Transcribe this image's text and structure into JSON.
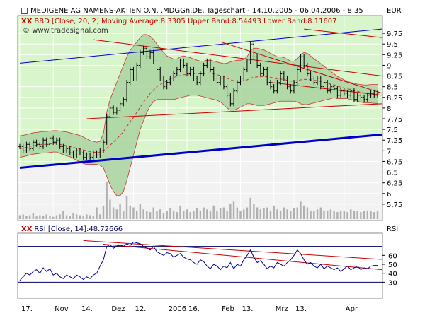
{
  "header": {
    "title": "MEDIGENE AG NAMENS-AKTIEN O.N. ,MDGGn.DE, Tageschart - 14.10.2005 - 06.04.2006 - 8.35",
    "bbd_legend": "BBD [Close, 20, 2] Moving Average:8.3305 Upper Band:8.54493 Lower Band:8.11607",
    "watermark": "www.tradesignal.com",
    "currency": "EUR"
  },
  "rsi_panel": {
    "legend": "RSI [Close, 14]:48.72666",
    "axis_label": "RSI"
  },
  "colors": {
    "upper_bg": "#d9f5cc",
    "lower_bg": "#f2f2f2",
    "band_fill": "#a9d3a0",
    "band_lower_excess": "#bdbdbd",
    "band_edge": "#cc3333",
    "moving_average": "#cc3333",
    "price": "#000000",
    "trend_blue": "#0000cc",
    "trend_red": "#cc0000",
    "rsi_line": "#000099",
    "volume": "#b0b0b0"
  },
  "chart_data": [
    {
      "type": "line",
      "title": "MEDIGENE AG NAMENS-AKTIEN O.N. ,MDGGn.DE, Tageschart - 14.10.2005 - 06.04.2006 - 8.35",
      "ylabel": "EUR",
      "ylim": [
        5.5,
        10.0
      ],
      "yticks": [
        "5,75",
        "6",
        "6,25",
        "6,5",
        "6,75",
        "7",
        "7,25",
        "7,5",
        "7,75",
        "8",
        "8,25",
        "8,5",
        "8,75",
        "9",
        "9,25",
        "9,5",
        "9,75"
      ],
      "xticks": [
        "17.",
        "Nov",
        "14.",
        "Dez",
        "12.",
        "2006",
        "16.",
        "Feb",
        "13.",
        "Mrz",
        "13.",
        "Apr"
      ],
      "series": [
        {
          "name": "Close",
          "values": [
            7.1,
            7.0,
            7.15,
            7.05,
            7.2,
            7.15,
            7.1,
            7.25,
            7.15,
            7.3,
            7.2,
            7.25,
            7.1,
            7.0,
            7.05,
            6.95,
            6.9,
            7.0,
            6.95,
            6.85,
            6.9,
            6.85,
            6.95,
            6.9,
            7.0,
            7.2,
            7.8,
            8.0,
            7.9,
            7.95,
            8.1,
            8.2,
            8.6,
            8.9,
            8.7,
            9.0,
            9.3,
            9.4,
            9.2,
            9.3,
            9.1,
            8.9,
            8.7,
            8.5,
            8.6,
            8.7,
            8.8,
            8.9,
            9.1,
            9.0,
            8.8,
            8.9,
            8.7,
            8.6,
            8.8,
            9.0,
            9.1,
            8.9,
            8.7,
            8.6,
            8.7,
            8.5,
            8.3,
            8.1,
            8.4,
            8.6,
            8.7,
            8.9,
            9.1,
            9.5,
            9.2,
            9.0,
            8.8,
            8.9,
            8.6,
            8.5,
            8.4,
            8.6,
            8.8,
            8.7,
            8.5,
            8.4,
            8.6,
            8.9,
            9.2,
            9.0,
            8.8,
            8.7,
            8.6,
            8.7,
            8.5,
            8.6,
            8.4,
            8.5,
            8.45,
            8.3,
            8.4,
            8.35,
            8.3,
            8.4,
            8.2,
            8.3,
            8.25,
            8.2,
            8.3,
            8.35,
            8.3,
            8.35
          ]
        },
        {
          "name": "Moving Average",
          "values": [
            7.05,
            7.06,
            7.08,
            7.1,
            7.12,
            7.13,
            7.14,
            7.15,
            7.15,
            7.16,
            7.17,
            7.17,
            7.15,
            7.13,
            7.12,
            7.1,
            7.08,
            7.06,
            7.04,
            7.02,
            7.0,
            6.98,
            6.97,
            6.96,
            6.97,
            7.0,
            7.06,
            7.13,
            7.2,
            7.28,
            7.36,
            7.45,
            7.56,
            7.68,
            7.78,
            7.9,
            8.02,
            8.14,
            8.24,
            8.34,
            8.42,
            8.5,
            8.55,
            8.6,
            8.64,
            8.68,
            8.72,
            8.74,
            8.76,
            8.78,
            8.78,
            8.8,
            8.8,
            8.8,
            8.8,
            8.8,
            8.82,
            8.82,
            8.8,
            8.78,
            8.76,
            8.74,
            8.7,
            8.66,
            8.64,
            8.63,
            8.63,
            8.64,
            8.66,
            8.7,
            8.72,
            8.73,
            8.73,
            8.74,
            8.73,
            8.72,
            8.7,
            8.68,
            8.68,
            8.67,
            8.65,
            8.63,
            8.63,
            8.64,
            8.66,
            8.67,
            8.67,
            8.66,
            8.65,
            8.64,
            8.62,
            8.6,
            8.58,
            8.56,
            8.54,
            8.51,
            8.49,
            8.47,
            8.45,
            8.43,
            8.41,
            8.39,
            8.37,
            8.35,
            8.34,
            8.34,
            8.33,
            8.33
          ]
        },
        {
          "name": "Upper Band",
          "values": [
            7.35,
            7.36,
            7.38,
            7.4,
            7.42,
            7.43,
            7.44,
            7.45,
            7.45,
            7.46,
            7.47,
            7.47,
            7.46,
            7.45,
            7.44,
            7.42,
            7.4,
            7.38,
            7.36,
            7.32,
            7.28,
            7.24,
            7.22,
            7.2,
            7.22,
            7.4,
            7.9,
            8.2,
            8.4,
            8.6,
            8.8,
            9.0,
            9.2,
            9.35,
            9.45,
            9.55,
            9.65,
            9.72,
            9.72,
            9.68,
            9.6,
            9.5,
            9.4,
            9.3,
            9.22,
            9.18,
            9.15,
            9.15,
            9.2,
            9.22,
            9.2,
            9.18,
            9.15,
            9.12,
            9.1,
            9.1,
            9.12,
            9.12,
            9.1,
            9.08,
            9.06,
            9.04,
            9.05,
            9.08,
            9.1,
            9.12,
            9.12,
            9.14,
            9.2,
            9.35,
            9.4,
            9.4,
            9.38,
            9.36,
            9.32,
            9.28,
            9.24,
            9.2,
            9.2,
            9.18,
            9.14,
            9.1,
            9.1,
            9.15,
            9.25,
            9.3,
            9.28,
            9.22,
            9.15,
            9.1,
            9.04,
            8.98,
            8.92,
            8.86,
            8.8,
            8.74,
            8.7,
            8.66,
            8.62,
            8.6,
            8.58,
            8.56,
            8.55,
            8.54,
            8.54,
            8.55,
            8.55,
            8.55
          ]
        },
        {
          "name": "Lower Band",
          "values": [
            6.85,
            6.86,
            6.88,
            6.9,
            6.92,
            6.93,
            6.94,
            6.95,
            6.95,
            6.96,
            6.97,
            6.97,
            6.94,
            6.91,
            6.88,
            6.86,
            6.82,
            6.78,
            6.74,
            6.7,
            6.68,
            6.68,
            6.68,
            6.68,
            6.66,
            6.6,
            6.4,
            6.2,
            6.05,
            5.95,
            5.95,
            6.05,
            6.3,
            6.6,
            6.9,
            7.2,
            7.5,
            7.7,
            7.9,
            8.05,
            8.15,
            8.2,
            8.2,
            8.2,
            8.2,
            8.2,
            8.2,
            8.22,
            8.24,
            8.26,
            8.28,
            8.3,
            8.3,
            8.3,
            8.28,
            8.26,
            8.24,
            8.22,
            8.2,
            8.18,
            8.14,
            8.08,
            8.0,
            7.95,
            7.95,
            7.98,
            8.02,
            8.06,
            8.1,
            8.1,
            8.08,
            8.06,
            8.06,
            8.06,
            8.08,
            8.1,
            8.12,
            8.14,
            8.16,
            8.16,
            8.16,
            8.16,
            8.16,
            8.14,
            8.1,
            8.08,
            8.08,
            8.1,
            8.12,
            8.14,
            8.16,
            8.18,
            8.2,
            8.22,
            8.24,
            8.22,
            8.22,
            8.22,
            8.22,
            8.2,
            8.18,
            8.16,
            8.14,
            8.12,
            8.12,
            8.12,
            8.11,
            8.11
          ]
        }
      ],
      "trendlines": [
        {
          "name": "blue-upper-trend",
          "color": "#0000cc",
          "from": [
            0,
            9.05
          ],
          "to": [
            107,
            9.85
          ],
          "width": 1
        },
        {
          "name": "blue-lower-trend",
          "color": "#0000cc",
          "from": [
            0,
            6.6
          ],
          "to": [
            107,
            7.38
          ],
          "width": 3
        },
        {
          "name": "red-resistance-1",
          "color": "#cc0000",
          "from": [
            22,
            9.6
          ],
          "to": [
            107,
            8.75
          ],
          "width": 1
        },
        {
          "name": "red-resistance-2",
          "color": "#cc0000",
          "from": [
            60,
            9.55
          ],
          "to": [
            107,
            8.35
          ],
          "width": 1
        },
        {
          "name": "red-support",
          "color": "#cc0000",
          "from": [
            20,
            7.75
          ],
          "to": [
            107,
            8.1
          ],
          "width": 1
        },
        {
          "name": "red-top-channel",
          "color": "#cc0000",
          "from": [
            85,
            9.85
          ],
          "to": [
            107,
            9.65
          ],
          "width": 1
        },
        {
          "name": "red-triangle-lower",
          "color": "#cc0000",
          "from": [
            75,
            8.6
          ],
          "to": [
            107,
            8.3
          ],
          "width": 1
        }
      ],
      "volume": [
        0.1,
        0.12,
        0.08,
        0.1,
        0.15,
        0.07,
        0.1,
        0.09,
        0.12,
        0.08,
        0.06,
        0.1,
        0.12,
        0.2,
        0.1,
        0.08,
        0.15,
        0.12,
        0.1,
        0.09,
        0.12,
        0.1,
        0.08,
        0.3,
        0.12,
        0.35,
        0.95,
        0.5,
        0.3,
        0.25,
        0.4,
        0.2,
        0.6,
        0.35,
        0.3,
        0.22,
        0.4,
        0.25,
        0.2,
        0.18,
        0.3,
        0.2,
        0.25,
        0.15,
        0.2,
        0.28,
        0.22,
        0.18,
        0.35,
        0.2,
        0.25,
        0.18,
        0.2,
        0.28,
        0.22,
        0.3,
        0.25,
        0.2,
        0.35,
        0.22,
        0.28,
        0.3,
        0.2,
        0.4,
        0.45,
        0.3,
        0.22,
        0.25,
        0.3,
        0.55,
        0.4,
        0.3,
        0.25,
        0.28,
        0.3,
        0.2,
        0.35,
        0.25,
        0.22,
        0.3,
        0.25,
        0.2,
        0.28,
        0.3,
        0.45,
        0.35,
        0.3,
        0.22,
        0.2,
        0.25,
        0.3,
        0.2,
        0.22,
        0.25,
        0.2,
        0.18,
        0.22,
        0.2,
        0.18,
        0.25,
        0.22,
        0.2,
        0.18,
        0.2,
        0.22,
        0.2,
        0.18,
        0.2
      ]
    },
    {
      "type": "line",
      "title": "RSI [Close, 14]:48.72666",
      "ylabel": "RSI",
      "ylim": [
        20,
        80
      ],
      "yticks": [
        "30",
        "40",
        "50",
        "60"
      ],
      "reference_lines": [
        30,
        70
      ],
      "series": [
        {
          "name": "RSI",
          "values": [
            32,
            36,
            40,
            38,
            42,
            44,
            40,
            46,
            42,
            45,
            38,
            40,
            36,
            34,
            38,
            36,
            34,
            38,
            36,
            33,
            36,
            34,
            38,
            40,
            48,
            55,
            70,
            72,
            68,
            70,
            72,
            70,
            73,
            71,
            75,
            74,
            73,
            70,
            68,
            66,
            70,
            64,
            62,
            60,
            63,
            62,
            58,
            60,
            62,
            58,
            56,
            55,
            52,
            50,
            55,
            53,
            48,
            45,
            50,
            48,
            44,
            48,
            46,
            52,
            45,
            50,
            48,
            55,
            60,
            66,
            58,
            52,
            54,
            50,
            45,
            48,
            46,
            52,
            50,
            48,
            52,
            55,
            60,
            66,
            62,
            55,
            50,
            52,
            48,
            46,
            50,
            45,
            48,
            46,
            44,
            46,
            42,
            45,
            48,
            44,
            46,
            48,
            44,
            46,
            45,
            48,
            48.7,
            48.7
          ]
        }
      ],
      "trendlines": [
        {
          "name": "rsi-red-upper",
          "color": "#cc0000",
          "from": [
            19,
            76.5
          ],
          "to": [
            107,
            55.5
          ],
          "width": 1
        },
        {
          "name": "rsi-red-lower",
          "color": "#cc0000",
          "from": [
            25,
            72.5
          ],
          "to": [
            107,
            44.0
          ],
          "width": 1
        }
      ]
    }
  ]
}
